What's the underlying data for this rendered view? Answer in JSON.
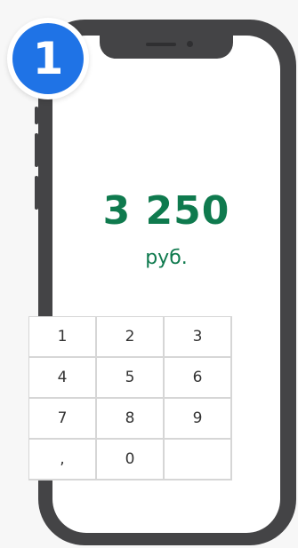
{
  "step_badge": {
    "number": "1"
  },
  "display": {
    "amount": "3 250",
    "currency": "руб.",
    "accent_color": "#0f7a4e"
  },
  "keypad": {
    "keys": [
      "1",
      "2",
      "3",
      "4",
      "5",
      "6",
      "7",
      "8",
      "9",
      ",",
      "0",
      ""
    ]
  },
  "colors": {
    "badge_blue": "#1f73e6",
    "phone_frame": "#444446"
  }
}
